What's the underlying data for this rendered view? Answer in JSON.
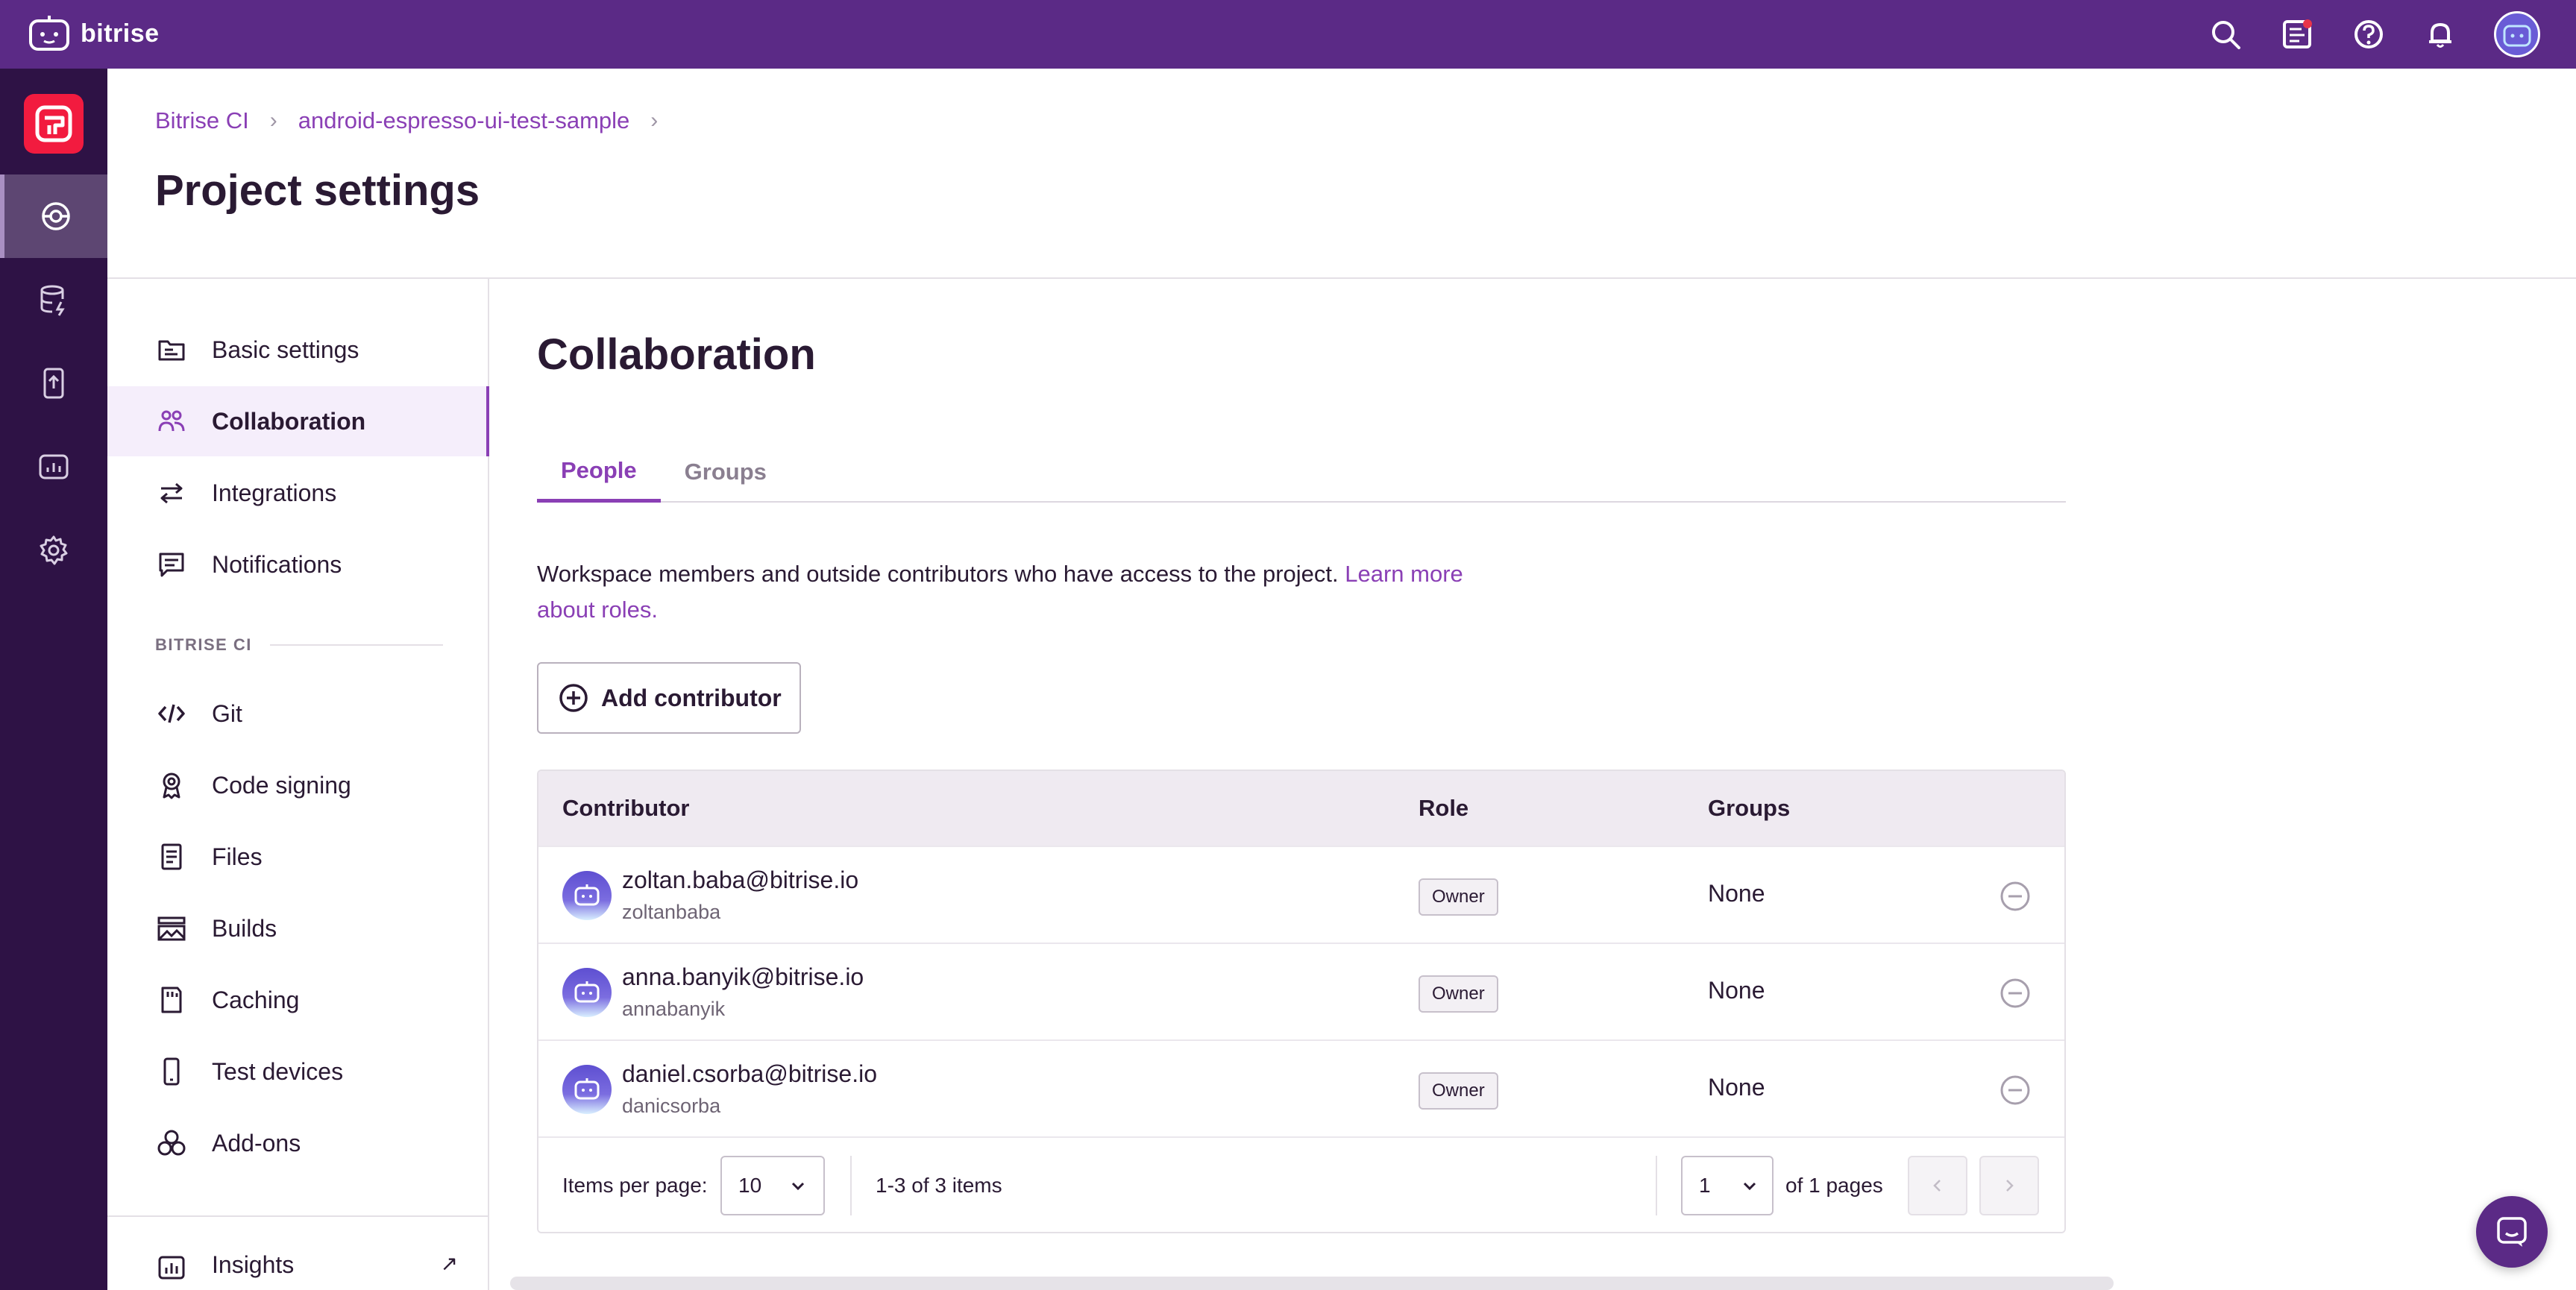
{
  "app": {
    "brand": "bitrise"
  },
  "breadcrumb": {
    "items": [
      "Bitrise CI",
      "android-espresso-ui-test-sample"
    ]
  },
  "header": {
    "title": "Project settings"
  },
  "settings_nav": {
    "items": [
      {
        "label": "Basic settings",
        "icon": "folder-icon",
        "active": false
      },
      {
        "label": "Collaboration",
        "icon": "people-icon",
        "active": true
      },
      {
        "label": "Integrations",
        "icon": "arrows-exchange-icon",
        "active": false
      },
      {
        "label": "Notifications",
        "icon": "message-icon",
        "active": false
      }
    ],
    "section_label": "BITRISE CI",
    "ci_items": [
      {
        "label": "Git",
        "icon": "code-icon"
      },
      {
        "label": "Code signing",
        "icon": "badge-ribbon-icon"
      },
      {
        "label": "Files",
        "icon": "file-icon"
      },
      {
        "label": "Builds",
        "icon": "builds-icon"
      },
      {
        "label": "Caching",
        "icon": "cache-icon"
      },
      {
        "label": "Test devices",
        "icon": "phone-icon"
      },
      {
        "label": "Add-ons",
        "icon": "addons-icon"
      }
    ],
    "bottom_item": {
      "label": "Insights",
      "icon": "chart-icon"
    }
  },
  "main": {
    "title": "Collaboration",
    "tabs": [
      {
        "label": "People",
        "active": true
      },
      {
        "label": "Groups",
        "active": false
      }
    ],
    "description": "Workspace members and outside contributors who have access to the project.",
    "learn_more": "Learn more about roles.",
    "add_button": "Add contributor"
  },
  "table": {
    "headers": {
      "contributor": "Contributor",
      "role": "Role",
      "groups": "Groups"
    },
    "rows": [
      {
        "email": "zoltan.baba@bitrise.io",
        "username": "zoltanbaba",
        "role": "Owner",
        "groups": "None"
      },
      {
        "email": "anna.banyik@bitrise.io",
        "username": "annabanyik",
        "role": "Owner",
        "groups": "None"
      },
      {
        "email": "daniel.csorba@bitrise.io",
        "username": "danicsorba",
        "role": "Owner",
        "groups": "None"
      }
    ],
    "footer": {
      "items_per_page_label": "Items per page:",
      "items_per_page_value": "10",
      "range": "1-3 of 3 items",
      "page_value": "1",
      "of_pages": "of 1 pages"
    }
  },
  "colors": {
    "topbar": "#5b2a86",
    "rail": "#2e1245",
    "accent": "#8a3fb5",
    "brand_red": "#f21b3f"
  }
}
